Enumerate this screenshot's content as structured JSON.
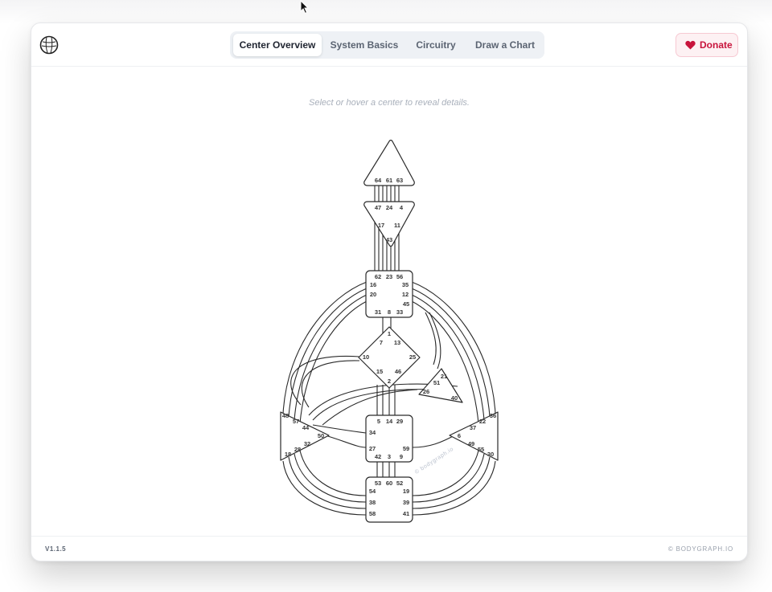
{
  "nav": {
    "tabs": [
      {
        "label": "Center Overview",
        "active": true
      },
      {
        "label": "System Basics",
        "active": false
      },
      {
        "label": "Circuitry",
        "active": false
      },
      {
        "label": "Draw a Chart",
        "active": false
      }
    ],
    "donate_label": "Donate"
  },
  "hint": "Select or hover a center to reveal details.",
  "chart": {
    "watermark": "© bodygraph.io",
    "centers": [
      {
        "name": "head",
        "gates": [
          "64",
          "61",
          "63"
        ]
      },
      {
        "name": "ajna",
        "gates": [
          "47",
          "24",
          "4",
          "17",
          "11",
          "43"
        ]
      },
      {
        "name": "throat",
        "gates": [
          "62",
          "23",
          "56",
          "16",
          "35",
          "20",
          "12",
          "45",
          "31",
          "8",
          "33"
        ]
      },
      {
        "name": "g",
        "gates": [
          "1",
          "7",
          "13",
          "10",
          "25",
          "15",
          "46",
          "2"
        ]
      },
      {
        "name": "heart",
        "gates": [
          "21",
          "51",
          "26",
          "40"
        ]
      },
      {
        "name": "sacral",
        "gates": [
          "5",
          "14",
          "29",
          "34",
          "27",
          "59",
          "42",
          "3",
          "9"
        ]
      },
      {
        "name": "spleen",
        "gates": [
          "48",
          "57",
          "44",
          "50",
          "32",
          "28",
          "18"
        ]
      },
      {
        "name": "solar-plexus",
        "gates": [
          "36",
          "22",
          "37",
          "6",
          "49",
          "55",
          "30"
        ]
      },
      {
        "name": "root",
        "gates": [
          "53",
          "60",
          "52",
          "54",
          "19",
          "38",
          "39",
          "58",
          "41"
        ]
      }
    ]
  },
  "footer": {
    "version": "V1.1.5",
    "copyright": "© BODYGRAPH.IO"
  },
  "colors": {
    "accent": "#c8143c",
    "text": "#1f2430",
    "muted": "#a9b0bb"
  }
}
